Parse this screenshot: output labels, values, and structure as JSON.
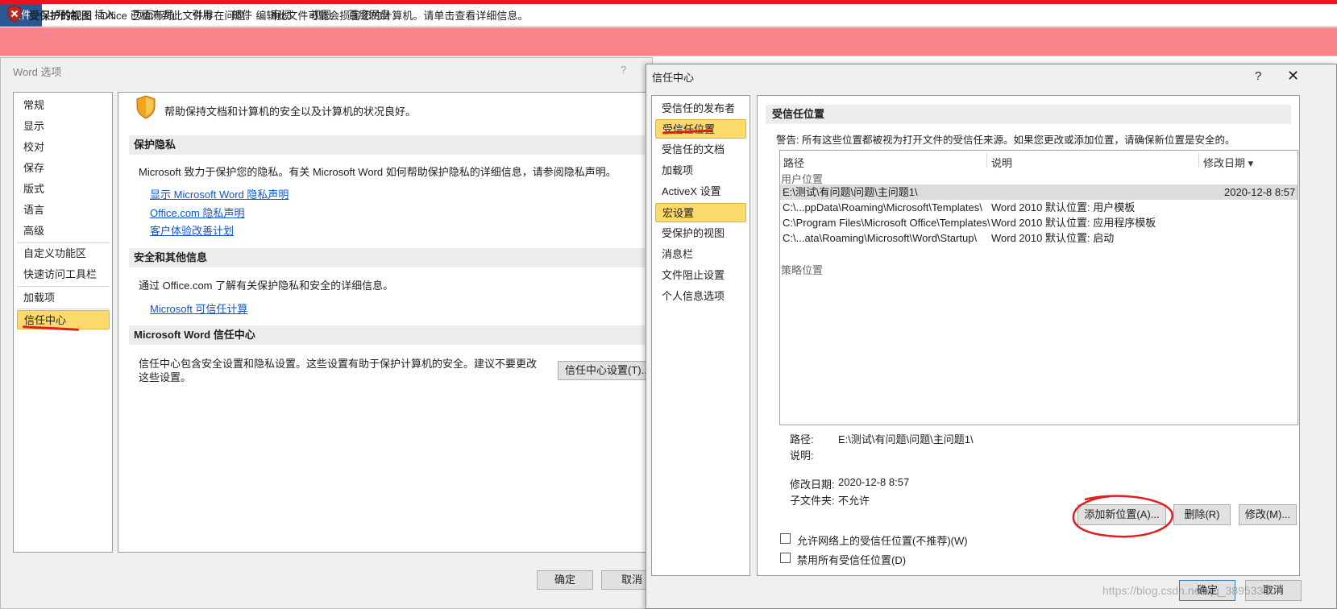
{
  "ribbon": {
    "tabs": [
      "文件",
      "开始",
      "插入",
      "页面布局",
      "引用",
      "邮件",
      "审阅",
      "视图",
      "百度网盘"
    ]
  },
  "protected_view": {
    "title": "受保护的视图",
    "message": "Office 已检测到此文件存在问题。编辑此文件可能会损害您的计算机。请单击查看详细信息。"
  },
  "word_options": {
    "title": "Word 选项",
    "help": "?",
    "nav": [
      "常规",
      "显示",
      "校对",
      "保存",
      "版式",
      "语言",
      "高级",
      "自定义功能区",
      "快速访问工具栏",
      "加载项",
      "信任中心"
    ],
    "selected_nav": "信任中心",
    "intro": "帮助保持文档和计算机的安全以及计算机的状况良好。",
    "privacy": {
      "heading": "保护隐私",
      "text": "Microsoft 致力于保护您的隐私。有关 Microsoft Word 如何帮助保护隐私的详细信息，请参阅隐私声明。",
      "links": [
        "显示 Microsoft Word 隐私声明",
        "Office.com 隐私声明",
        "客户体验改善计划"
      ]
    },
    "security": {
      "heading": "安全和其他信息",
      "text": "通过 Office.com 了解有关保护隐私和安全的详细信息。",
      "link": "Microsoft 可信任计算"
    },
    "trust_center": {
      "heading": "Microsoft Word 信任中心",
      "text_line1": "信任中心包含安全设置和隐私设置。这些设置有助于保护计算机的安全。建议不要更改",
      "text_line2": "这些设置。",
      "button": "信任中心设置(T)..."
    },
    "ok": "确定",
    "cancel": "取消"
  },
  "trust_center": {
    "title": "信任中心",
    "help": "?",
    "close": "✕",
    "nav": [
      "受信任的发布者",
      "受信任位置",
      "受信任的文档",
      "加载项",
      "ActiveX 设置",
      "宏设置",
      "受保护的视图",
      "消息栏",
      "文件阻止设置",
      "个人信息选项"
    ],
    "heading": "受信任位置",
    "warning": "警告: 所有这些位置都被视为打开文件的受信任来源。如果您更改或添加位置，请确保新位置是安全的。",
    "columns": [
      "路径",
      "说明",
      "修改日期 ▾"
    ],
    "user_group": "用户位置",
    "policy_group": "策略位置",
    "rows": [
      {
        "path": "E:\\测试\\有问题\\问题\\主问题1\\",
        "desc": "",
        "date": "2020-12-8 8:57"
      },
      {
        "path": "C:\\...ppData\\Roaming\\Microsoft\\Templates\\",
        "desc": "Word 2010 默认位置: 用户模板",
        "date": ""
      },
      {
        "path": "C:\\Program Files\\Microsoft Office\\Templates\\",
        "desc": "Word 2010 默认位置: 应用程序模板",
        "date": ""
      },
      {
        "path": "C:\\...ata\\Roaming\\Microsoft\\Word\\Startup\\",
        "desc": "Word 2010 默认位置: 启动",
        "date": ""
      }
    ],
    "details": {
      "path_label": "路径:",
      "path_value": "E:\\测试\\有问题\\问题\\主问题1\\",
      "desc_label": "说明:",
      "date_label": "修改日期:",
      "date_value": "2020-12-8 8:57",
      "sub_label": "子文件夹:",
      "sub_value": "不允许"
    },
    "buttons": {
      "add": "添加新位置(A)...",
      "remove": "删除(R)",
      "modify": "修改(M)..."
    },
    "checkboxes": [
      "允许网络上的受信任位置(不推荐)(W)",
      "禁用所有受信任位置(D)"
    ],
    "ok": "确定",
    "cancel": "取消"
  },
  "watermark": "https://blog.csdn.net/qq_38953320",
  "colors": {
    "accent_red": "#e8141e",
    "file_tab": "#2b5797",
    "selection": "#fbd96b",
    "pv_bar": "#f9858a",
    "link": "#1155cc"
  }
}
